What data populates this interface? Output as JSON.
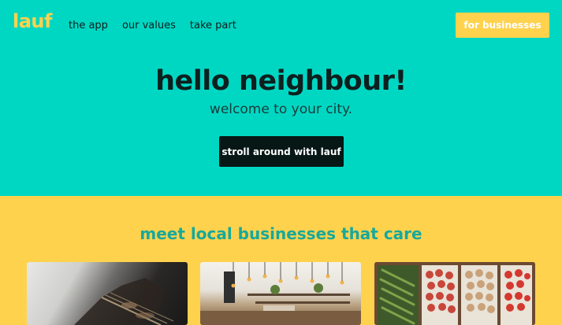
{
  "brand": {
    "logo": "lauf"
  },
  "nav": {
    "items": [
      "the app",
      "our values",
      "take part"
    ]
  },
  "header": {
    "cta_label": "for businesses"
  },
  "hero": {
    "title": "hello neighbour!",
    "subtitle": "welcome to your city.",
    "cta_label": "stroll around with lauf"
  },
  "section": {
    "title": "meet local businesses that care"
  },
  "cards": [
    {
      "image": "guitar-photo"
    },
    {
      "image": "cafe-interior-photo"
    },
    {
      "image": "produce-market-photo"
    }
  ],
  "colors": {
    "teal": "#00d7c3",
    "yellow": "#ffd24d",
    "dark": "#061716",
    "section_title": "#16a99c"
  }
}
